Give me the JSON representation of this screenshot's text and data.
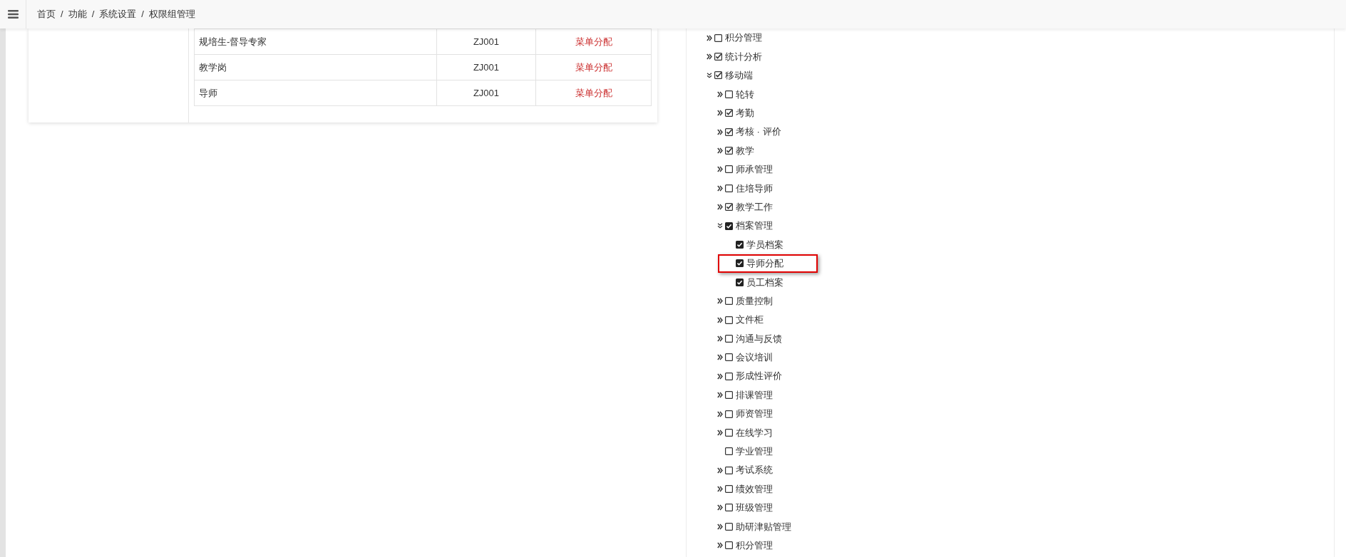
{
  "breadcrumb": [
    {
      "label": "首页",
      "separator": "/"
    },
    {
      "label": "功能",
      "separator": "/"
    },
    {
      "label": "系统设置",
      "separator": "/"
    },
    {
      "label": "权限组管理"
    }
  ],
  "table": {
    "rows": [
      {
        "name": "规培生-督导专家",
        "code": "ZJ001",
        "action": "菜单分配"
      },
      {
        "name": "教学岗",
        "code": "ZJ001",
        "action": "菜单分配"
      },
      {
        "name": "导师",
        "code": "ZJ001",
        "action": "菜单分配"
      }
    ]
  },
  "tree": [
    {
      "label": "积分管理",
      "kind": "branch",
      "expanded": false,
      "solid": false,
      "checked": false
    },
    {
      "label": "统计分析",
      "kind": "branch",
      "expanded": false,
      "solid": false,
      "checked": true
    },
    {
      "label": "移动端",
      "kind": "branch",
      "expanded": true,
      "solid": false,
      "checked": true,
      "children": [
        {
          "label": "轮转",
          "kind": "branch",
          "expanded": false,
          "solid": false,
          "checked": false
        },
        {
          "label": "考勤",
          "kind": "branch",
          "expanded": false,
          "solid": false,
          "checked": true
        },
        {
          "label": "考核 · 评价",
          "kind": "branch",
          "expanded": false,
          "solid": false,
          "checked": true
        },
        {
          "label": "教学",
          "kind": "branch",
          "expanded": false,
          "solid": false,
          "checked": true
        },
        {
          "label": "师承管理",
          "kind": "branch",
          "expanded": false,
          "solid": false,
          "checked": false
        },
        {
          "label": "住培导师",
          "kind": "branch",
          "expanded": false,
          "solid": false,
          "checked": false
        },
        {
          "label": "教学工作",
          "kind": "branch",
          "expanded": false,
          "solid": false,
          "checked": true
        },
        {
          "label": "档案管理",
          "kind": "branch",
          "expanded": true,
          "solid": true,
          "checked": true,
          "children": [
            {
              "label": "学员档案",
              "kind": "leaf",
              "solid": true,
              "checked": true,
              "highlighted": false
            },
            {
              "label": "导师分配",
              "kind": "leaf",
              "solid": true,
              "checked": true,
              "highlighted": true
            },
            {
              "label": "员工档案",
              "kind": "leaf",
              "solid": true,
              "checked": true,
              "highlighted": false
            }
          ]
        },
        {
          "label": "质量控制",
          "kind": "branch",
          "expanded": false,
          "solid": false,
          "checked": false
        },
        {
          "label": "文件柜",
          "kind": "branch",
          "expanded": false,
          "solid": false,
          "checked": false
        },
        {
          "label": "沟通与反馈",
          "kind": "branch",
          "expanded": false,
          "solid": false,
          "checked": false
        },
        {
          "label": "会议培训",
          "kind": "branch",
          "expanded": false,
          "solid": false,
          "checked": false
        },
        {
          "label": "形成性评价",
          "kind": "branch",
          "expanded": false,
          "solid": false,
          "checked": false
        },
        {
          "label": "排课管理",
          "kind": "branch",
          "expanded": false,
          "solid": false,
          "checked": false
        },
        {
          "label": "师资管理",
          "kind": "branch",
          "expanded": false,
          "solid": false,
          "checked": false
        },
        {
          "label": "在线学习",
          "kind": "branch",
          "expanded": false,
          "solid": false,
          "checked": false
        },
        {
          "label": "学业管理",
          "kind": "leaf",
          "solid": false,
          "checked": false
        },
        {
          "label": "考试系统",
          "kind": "branch",
          "expanded": false,
          "solid": false,
          "checked": false
        },
        {
          "label": "绩效管理",
          "kind": "branch",
          "expanded": false,
          "solid": false,
          "checked": false
        },
        {
          "label": "班级管理",
          "kind": "branch",
          "expanded": false,
          "solid": false,
          "checked": false
        },
        {
          "label": "助研津贴管理",
          "kind": "branch",
          "expanded": false,
          "solid": false,
          "checked": false
        },
        {
          "label": "积分管理",
          "kind": "branch",
          "expanded": false,
          "solid": false,
          "checked": false
        }
      ]
    }
  ]
}
